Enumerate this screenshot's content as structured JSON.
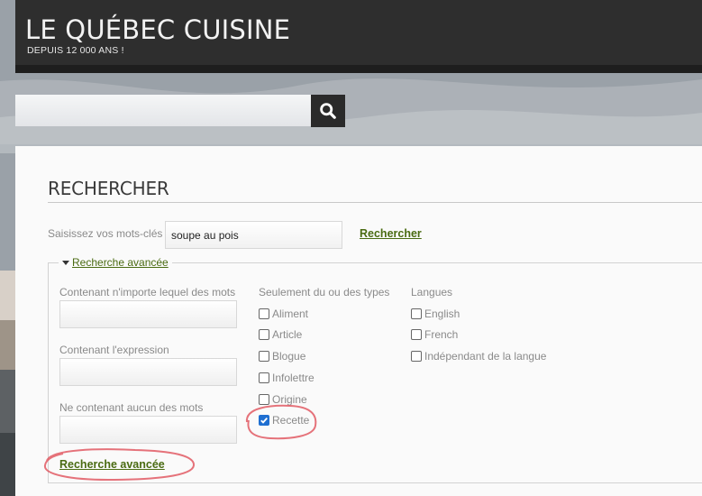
{
  "header": {
    "title": "LE QUÉBEC CUISINE",
    "subtitle": "DEPUIS 12 000 ANS !"
  },
  "top_search": {
    "placeholder": "",
    "icon": "search-icon"
  },
  "main": {
    "title": "RECHERCHER",
    "keywords_label": "Saisissez vos mots-clés",
    "keywords_value": "soupe au pois",
    "search_link": "Rechercher",
    "advanced_legend": "Recherche avancée",
    "columns": {
      "contains_any_label": "Contenant n'importe lequel des mots",
      "contains_phrase_label": "Contenant l'expression",
      "contains_none_label": "Ne contenant aucun des mots",
      "types_label": "Seulement du ou des types",
      "languages_label": "Langues"
    },
    "types": [
      {
        "label": "Aliment",
        "checked": false
      },
      {
        "label": "Article",
        "checked": false
      },
      {
        "label": "Blogue",
        "checked": false
      },
      {
        "label": "Infolettre",
        "checked": false
      },
      {
        "label": "Origine",
        "checked": false
      },
      {
        "label": "Recette",
        "checked": true
      }
    ],
    "languages": [
      {
        "label": "English",
        "checked": false
      },
      {
        "label": "French",
        "checked": false
      },
      {
        "label": "Indépendant de la langue",
        "checked": false
      }
    ],
    "advanced_button": "Recherche avancée"
  },
  "colors": {
    "header_bg": "#2e2e2e",
    "link_green": "#4a6b12",
    "annotation_red": "#e0505a",
    "checkbox_blue": "#1f6fd1"
  }
}
